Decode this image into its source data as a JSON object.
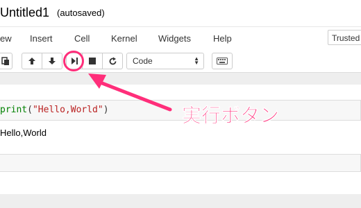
{
  "header": {
    "title": "Untitled1",
    "status": "(autosaved)"
  },
  "menu": {
    "items": [
      "ew",
      "Insert",
      "Cell",
      "Kernel",
      "Widgets",
      "Help"
    ],
    "trusted": "Trusted"
  },
  "toolbar": {
    "icons": [
      "paste-cells-icon",
      "move-up-icon",
      "move-down-icon",
      "run-cell-icon",
      "interrupt-icon",
      "restart-icon",
      "keyboard-icon"
    ],
    "cell_type": "Code"
  },
  "annotation": {
    "label": "実行ボタン",
    "color": "#ff2e7a"
  },
  "notebook": {
    "cell_code": {
      "fn": "print",
      "open": "(",
      "arg": "\"Hello,World\"",
      "close": ")"
    },
    "output": "Hello,World"
  }
}
